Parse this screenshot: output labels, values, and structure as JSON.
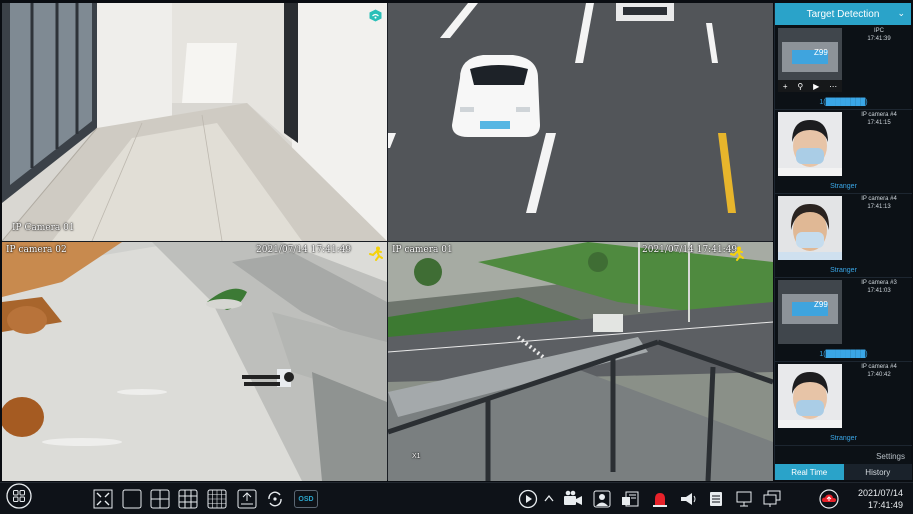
{
  "cameras": [
    {
      "name": "IP Camera 01",
      "timestamp": ""
    },
    {
      "name": "",
      "timestamp": ""
    },
    {
      "name": "IP camera 02",
      "timestamp": "2021/07/14 17:41:49"
    },
    {
      "name": "IP camera 01",
      "timestamp": "2021/07/14 17:41:49",
      "zoom": "X1"
    }
  ],
  "panel": {
    "title": "Target Detection",
    "events": [
      {
        "camera": "IPC",
        "time": "17:41:39",
        "label": "1(████████)",
        "plate": "Z99",
        "type": "plate"
      },
      {
        "camera": "IP camera #4",
        "time": "17:41:15",
        "label": "Stranger",
        "type": "face"
      },
      {
        "camera": "IP camera #4",
        "time": "17:41:13",
        "label": "Stranger",
        "type": "face"
      },
      {
        "camera": "IP camera #3",
        "time": "17:41:03",
        "label": "1(████████)",
        "plate": "Z99",
        "type": "plate"
      },
      {
        "camera": "IP camera #4",
        "time": "17:40:42",
        "label": "Stranger",
        "type": "face"
      }
    ],
    "settings_label": "Settings",
    "tabs": [
      "Real Time",
      "History"
    ]
  },
  "toolbar": {
    "osd_label": "OSD",
    "date": "2021/07/14",
    "time": "17:41:49"
  },
  "colors": {
    "accent": "#2aa3c9",
    "label_blue": "#3aa6e6",
    "alarm_red": "#e8222a",
    "motion_yellow": "#f5d20a"
  }
}
